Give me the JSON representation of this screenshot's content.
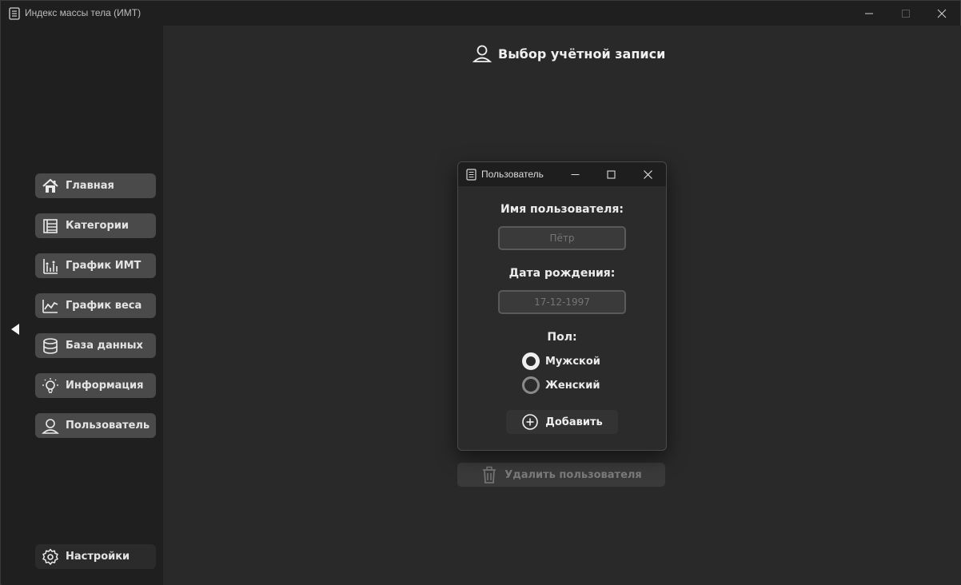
{
  "window": {
    "title": "Индекс массы тела (ИМТ)",
    "controls": [
      "minimize-icon",
      "maximize-icon",
      "close-icon"
    ]
  },
  "sidebar": {
    "items": [
      {
        "label": "Главная",
        "icon": "home-icon"
      },
      {
        "label": "Категории",
        "icon": "categories-icon"
      },
      {
        "label": "График ИМТ",
        "icon": "bmi-chart-icon"
      },
      {
        "label": "График веса",
        "icon": "weight-chart-icon"
      },
      {
        "label": "База данных",
        "icon": "database-icon"
      },
      {
        "label": "Информация",
        "icon": "lightbulb-icon"
      },
      {
        "label": "Пользователь",
        "icon": "user-icon"
      }
    ],
    "settings": {
      "label": "Настройки",
      "icon": "gear-icon"
    },
    "collapse_icon": "triangle-left-icon"
  },
  "main": {
    "header": {
      "title": "Выбор учётной записи",
      "icon": "user-icon"
    },
    "delete_button": {
      "label": "Удалить пользователя",
      "icon": "trash-icon"
    }
  },
  "dialog": {
    "title": "Пользователь",
    "username_label": "Имя пользователя:",
    "username_placeholder": "Пётр",
    "birthdate_label": "Дата рождения:",
    "birthdate_placeholder": "17-12-1997",
    "gender_label": "Пол:",
    "gender_options": [
      {
        "label": "Мужской",
        "checked": true
      },
      {
        "label": "Женский",
        "checked": false
      }
    ],
    "add_button": {
      "label": "Добавить",
      "icon": "plus-circle-icon"
    }
  },
  "colors": {
    "background": "#1f1f1f",
    "main_background": "#292929",
    "nav_button": "#4a4a4a",
    "dialog_background": "#2b2b2b",
    "text": "#e6e6e6",
    "disabled_text": "#7b7b7b"
  }
}
